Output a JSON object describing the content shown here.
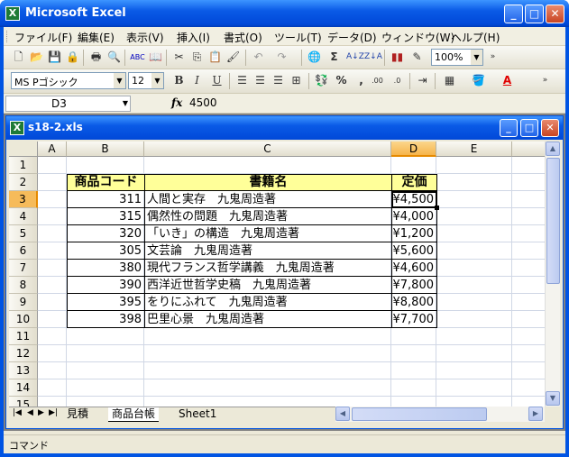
{
  "app": {
    "title": "Microsoft Excel"
  },
  "menu": [
    "ファイル(F)",
    "編集(E)",
    "表示(V)",
    "挿入(I)",
    "書式(O)",
    "ツール(T)",
    "データ(D)",
    "ウィンドウ(W)",
    "ヘルプ(H)"
  ],
  "toolbar": {
    "zoom": "100%",
    "font": "MS Pゴシック",
    "size": "12",
    "bold": "B",
    "italic": "I",
    "underline": "U",
    "sigma": "Σ",
    "percent": "%",
    "comma": ","
  },
  "formula": {
    "name_box": "D3",
    "fx": "fx",
    "value": "4500"
  },
  "workbook": {
    "title": "s18-2.xls"
  },
  "columns": [
    "A",
    "B",
    "C",
    "D",
    "E"
  ],
  "rows": [
    "1",
    "2",
    "3",
    "4",
    "5",
    "6",
    "7",
    "8",
    "9",
    "10",
    "11",
    "12",
    "13",
    "14",
    "15"
  ],
  "table": {
    "headers": [
      "商品コード",
      "書籍名",
      "定価"
    ],
    "rows": [
      {
        "code": "311",
        "title": "人間と実存　九鬼周造著",
        "price": "¥4,500"
      },
      {
        "code": "315",
        "title": "偶然性の問題　九鬼周造著",
        "price": "¥4,000"
      },
      {
        "code": "320",
        "title": "「いき」の構造　九鬼周造著",
        "price": "¥1,200"
      },
      {
        "code": "305",
        "title": "文芸論　九鬼周造著",
        "price": "¥5,600"
      },
      {
        "code": "380",
        "title": "現代フランス哲学講義　九鬼周造著",
        "price": "¥4,600"
      },
      {
        "code": "390",
        "title": "西洋近世哲学史稿　九鬼周造著",
        "price": "¥7,800"
      },
      {
        "code": "395",
        "title": "をりにふれて　九鬼周造著",
        "price": "¥8,800"
      },
      {
        "code": "398",
        "title": "巴里心景　九鬼周造著",
        "price": "¥7,700"
      }
    ]
  },
  "sheets": [
    "見積",
    "商品台帳",
    "Sheet1"
  ],
  "status": "コマンド",
  "colors": {
    "header_fill": "#ffff99",
    "selection": "#f6b44b",
    "title_blue": "#0054e3"
  }
}
